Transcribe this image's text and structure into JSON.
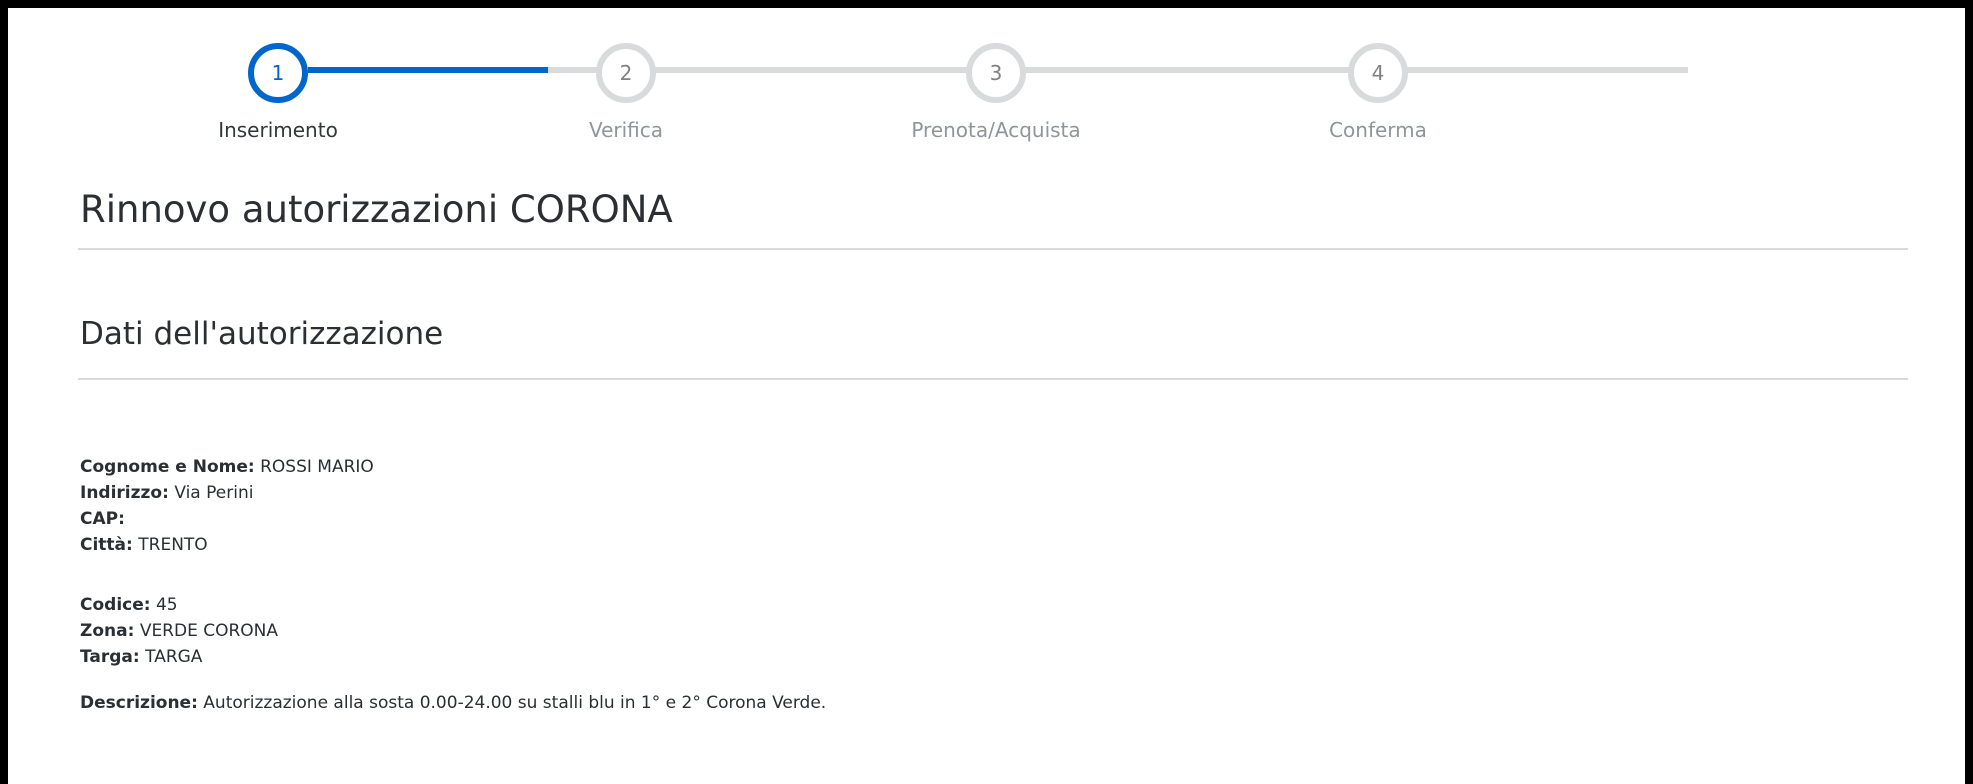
{
  "stepper": {
    "steps": [
      {
        "number": "1",
        "label": "Inserimento",
        "state": "active"
      },
      {
        "number": "2",
        "label": "Verifica",
        "state": "pending"
      },
      {
        "number": "3",
        "label": "Prenota/Acquista",
        "state": "pending"
      },
      {
        "number": "4",
        "label": "Conferma",
        "state": "pending"
      }
    ],
    "active_color": "#0066cc",
    "inactive_color": "#d9dadb"
  },
  "page": {
    "title": "Rinnovo autorizzazioni CORONA",
    "section_title": "Dati dell'autorizzazione"
  },
  "details": {
    "owner": {
      "name_label": "Cognome e Nome",
      "name_value": "ROSSI MARIO",
      "address_label": "Indirizzo",
      "address_value": "Via Perini",
      "cap_label": "CAP",
      "cap_value": "",
      "city_label": "Città",
      "city_value": "TRENTO"
    },
    "permit": {
      "code_label": "Codice",
      "code_value": "45",
      "zone_label": "Zona",
      "zone_value": "VERDE CORONA",
      "plate_label": "Targa",
      "plate_value": "TARGA"
    },
    "description_label": "Descrizione:",
    "description_value": "Autorizzazione alla sosta 0.00-24.00 su stalli blu in 1° e 2° Corona Verde."
  }
}
